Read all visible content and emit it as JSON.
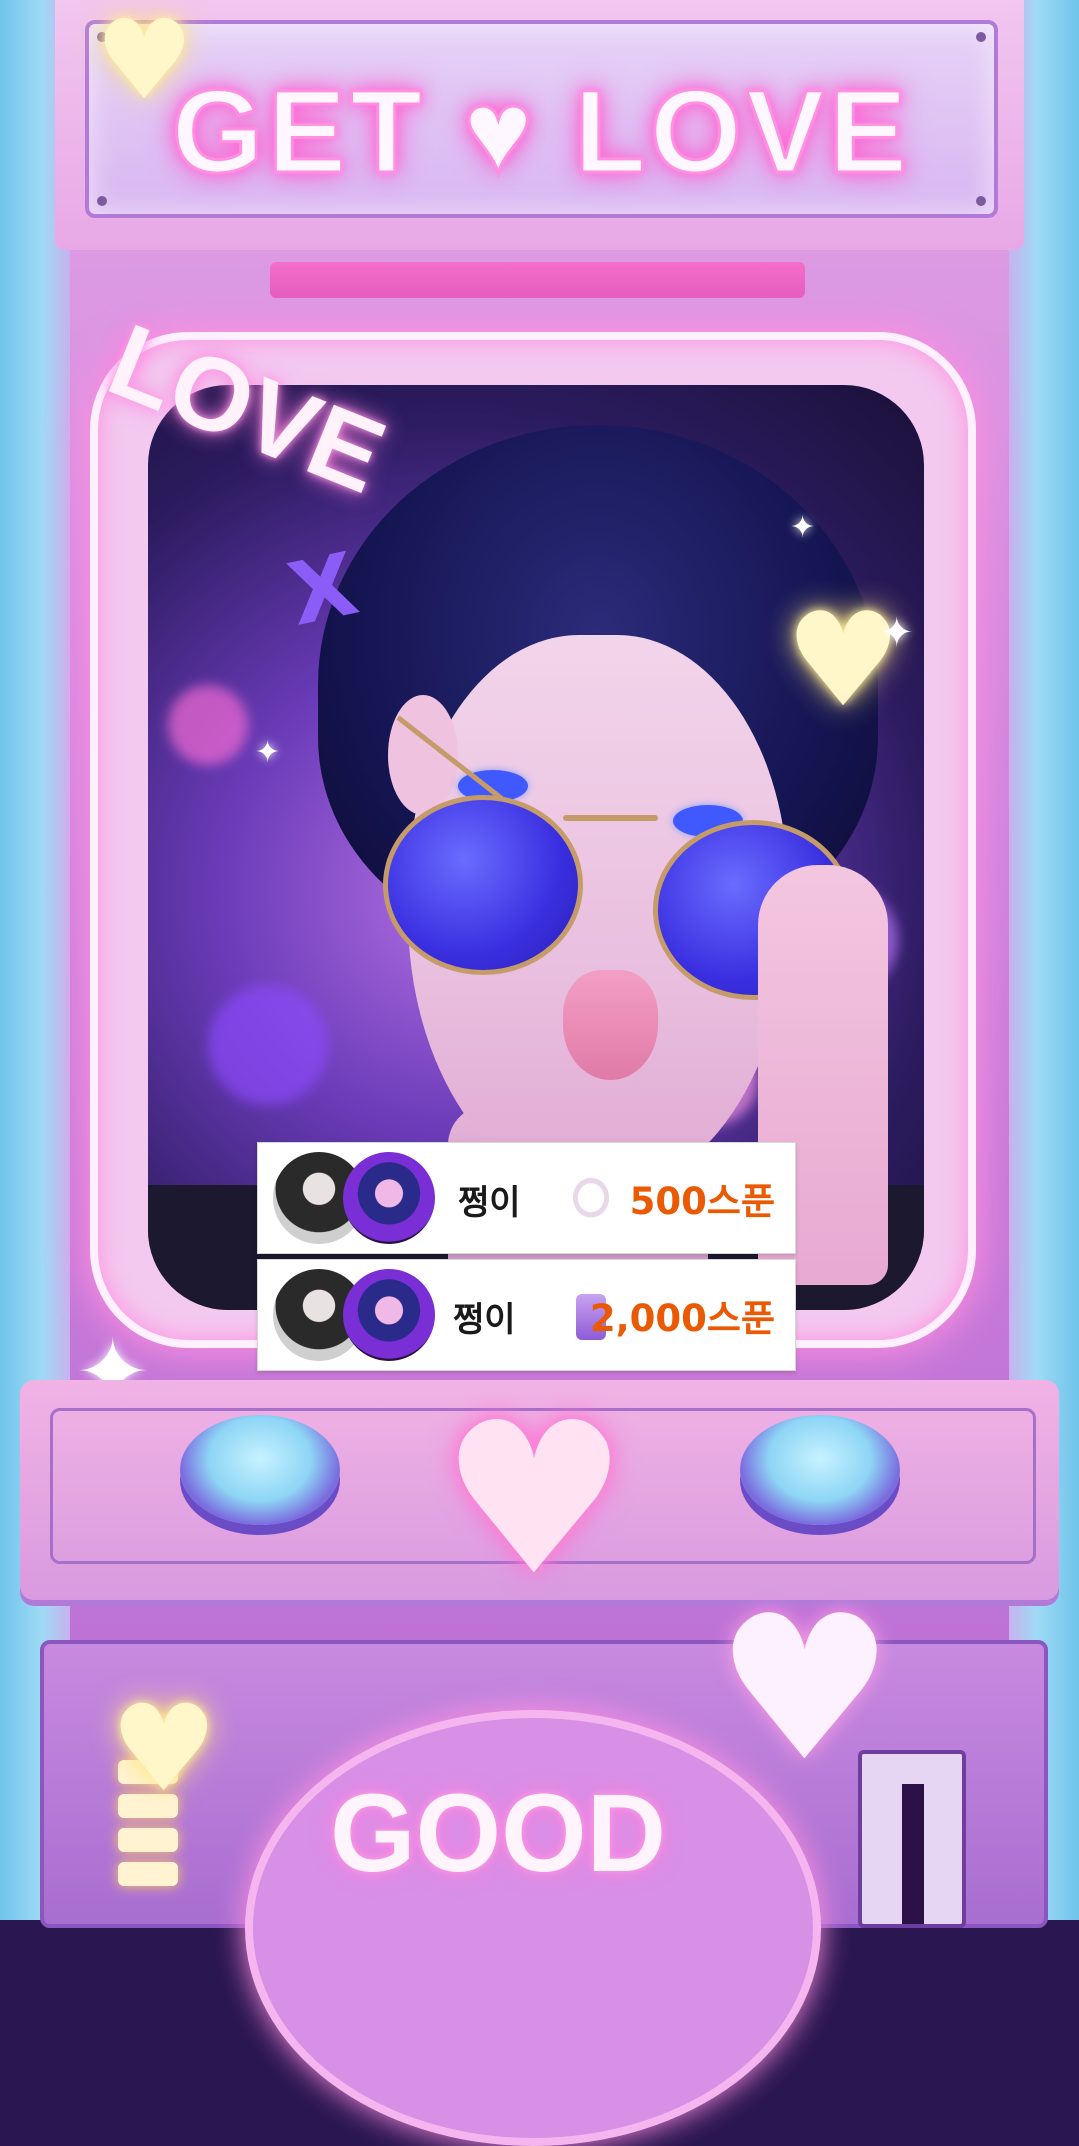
{
  "marquee": {
    "title": "GET ♥ LOVE"
  },
  "screen": {
    "neon_word": "LOVE",
    "x_mark": "X"
  },
  "gifts": [
    {
      "name": "쩡이",
      "item_icon": "teacup-icon",
      "amount": "500스푼"
    },
    {
      "name": "쩡이",
      "item_icon": "arcade-machine-icon",
      "amount": "2,000스푼"
    }
  ],
  "panel": {
    "bottom_text": "GOOD"
  },
  "colors": {
    "amount_orange": "#ea5a05",
    "neon_pink": "#ff7ede",
    "cabinet_pink": "#e3a5e6"
  }
}
